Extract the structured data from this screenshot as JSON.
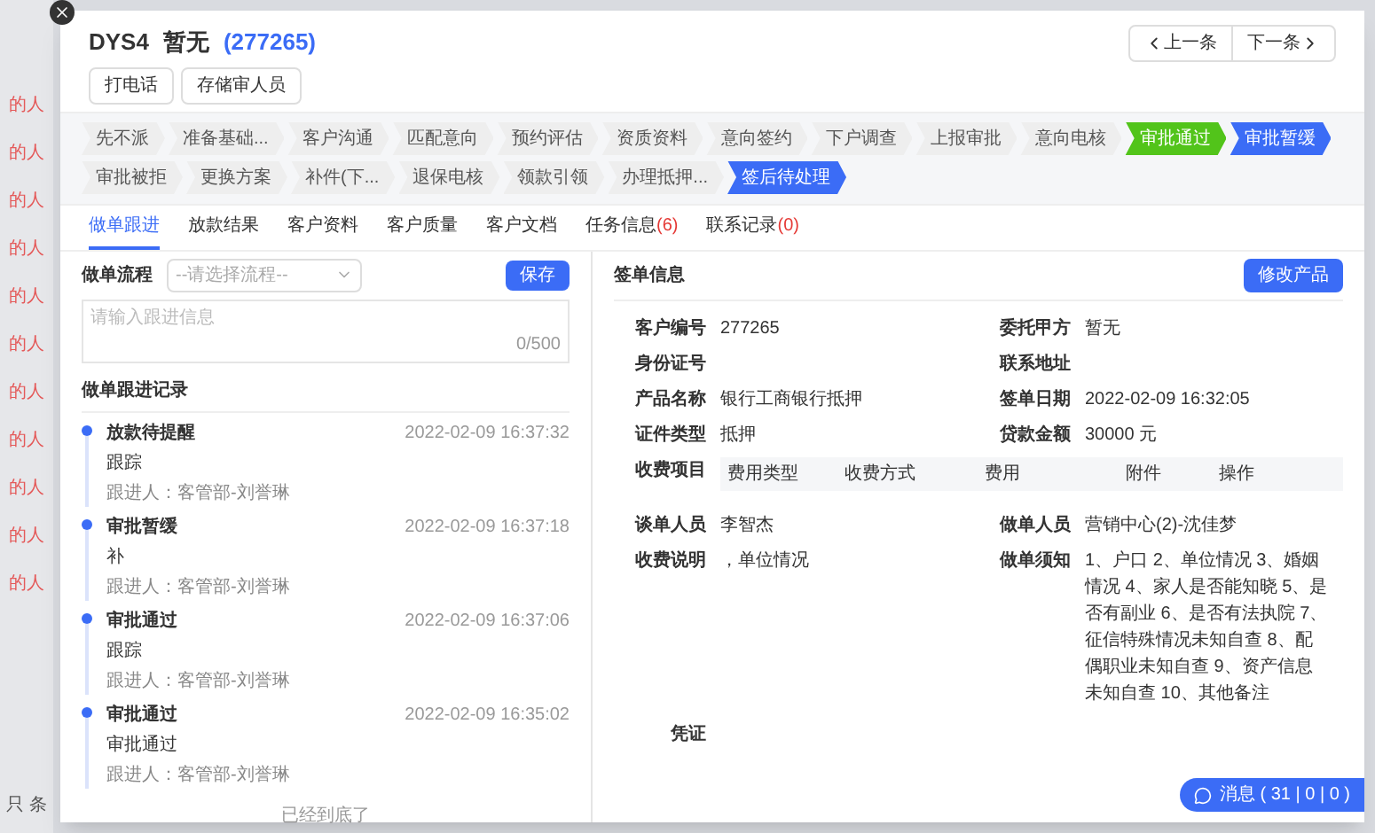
{
  "background_list": {
    "items": [
      "的人",
      "的人",
      "的人",
      "的人",
      "的人",
      "的人",
      "的人",
      "的人",
      "的人",
      "的人",
      "的人"
    ],
    "footer": "只 条"
  },
  "header": {
    "code": "DYS4",
    "name": "暂无",
    "id": "(277265)",
    "buttons": [
      "打电话",
      "存储审人员"
    ],
    "nav": [
      "上一条",
      "下一条"
    ]
  },
  "steps": [
    {
      "label": "先不派",
      "kind": "default"
    },
    {
      "label": "准备基础...",
      "kind": "default"
    },
    {
      "label": "客户沟通",
      "kind": "default"
    },
    {
      "label": "匹配意向",
      "kind": "default"
    },
    {
      "label": "预约评估",
      "kind": "default"
    },
    {
      "label": "资质资料",
      "kind": "default"
    },
    {
      "label": "意向签约",
      "kind": "default"
    },
    {
      "label": "下户调查",
      "kind": "default"
    },
    {
      "label": "上报审批",
      "kind": "default"
    },
    {
      "label": "意向电核",
      "kind": "default"
    },
    {
      "label": "审批通过",
      "kind": "success"
    },
    {
      "label": "审批暂缓",
      "kind": "active"
    },
    {
      "label": "审批被拒",
      "kind": "default"
    },
    {
      "label": "更换方案",
      "kind": "default"
    },
    {
      "label": "补件(下...",
      "kind": "default"
    },
    {
      "label": "退保电核",
      "kind": "default"
    },
    {
      "label": "领款引领",
      "kind": "default"
    },
    {
      "label": "办理抵押...",
      "kind": "default"
    },
    {
      "label": "签后待处理",
      "kind": "active"
    }
  ],
  "tabs": [
    {
      "label": "做单跟进",
      "selected": true
    },
    {
      "label": "放款结果",
      "selected": false
    },
    {
      "label": "客户资料",
      "selected": false
    },
    {
      "label": "客户质量",
      "selected": false
    },
    {
      "label": "客户文档",
      "selected": false
    },
    {
      "label": "任务信息",
      "count": "(6)",
      "selected": false
    },
    {
      "label": "联系记录",
      "count": "(0)",
      "selected": false
    }
  ],
  "flow": {
    "label": "做单流程",
    "select_placeholder": "--请选择流程--",
    "save": "保存",
    "placeholder": "请输入跟进信息",
    "counter": "0/500"
  },
  "records": {
    "title": "做单跟进记录",
    "end": "已经到底了",
    "items": [
      {
        "title": "放款待提醒",
        "time": "2022-02-09 16:37:32",
        "content": "跟踪",
        "person": "跟进人：客管部-刘誉琳"
      },
      {
        "title": "审批暂缓",
        "time": "2022-02-09 16:37:18",
        "content": "补",
        "person": "跟进人：客管部-刘誉琳"
      },
      {
        "title": "审批通过",
        "time": "2022-02-09 16:37:06",
        "content": "跟踪",
        "person": "跟进人：客管部-刘誉琳"
      },
      {
        "title": "审批通过",
        "time": "2022-02-09 16:35:02",
        "content": "审批通过",
        "person": "跟进人：客管部-刘誉琳"
      }
    ]
  },
  "order": {
    "title": "签单信息",
    "button": "修改产品",
    "fields": [
      {
        "label": "客户编号",
        "value": "277265"
      },
      {
        "label": "委托甲方",
        "value": "暂无"
      },
      {
        "label": "身份证号"
      },
      {
        "label": "联系地址"
      },
      {
        "label": "产品名称",
        "value": "银行工商银行抵押"
      },
      {
        "label": "签单日期",
        "value": "2022-02-09 16:32:05"
      },
      {
        "label": "证件类型",
        "value": "抵押"
      },
      {
        "label": "贷款金额",
        "value": "30000 元"
      }
    ],
    "fee_label": "收费项目",
    "fee_columns": [
      "费用类型",
      "收费方式",
      "费用",
      "附件",
      "操作"
    ],
    "fields2": [
      {
        "label": "谈单人员",
        "value": "李智杰"
      },
      {
        "label": "做单人员",
        "value": "营销中心(2)-沈佳梦"
      },
      {
        "label": "收费说明",
        "value": "，单位情况"
      },
      {
        "label": "做单须知",
        "value": "1、户口 2、单位情况 3、婚姻情况 4、家人是否能知晓 5、是否有副业 6、是否有法执院 7、征信特殊情况未知自查 8、配偶职业未知自查 9、资产信息未知自查 10、其他备注"
      }
    ],
    "voucher": "凭证"
  },
  "messages": {
    "text": "消息 ( 31 | 0 | 0 )"
  }
}
